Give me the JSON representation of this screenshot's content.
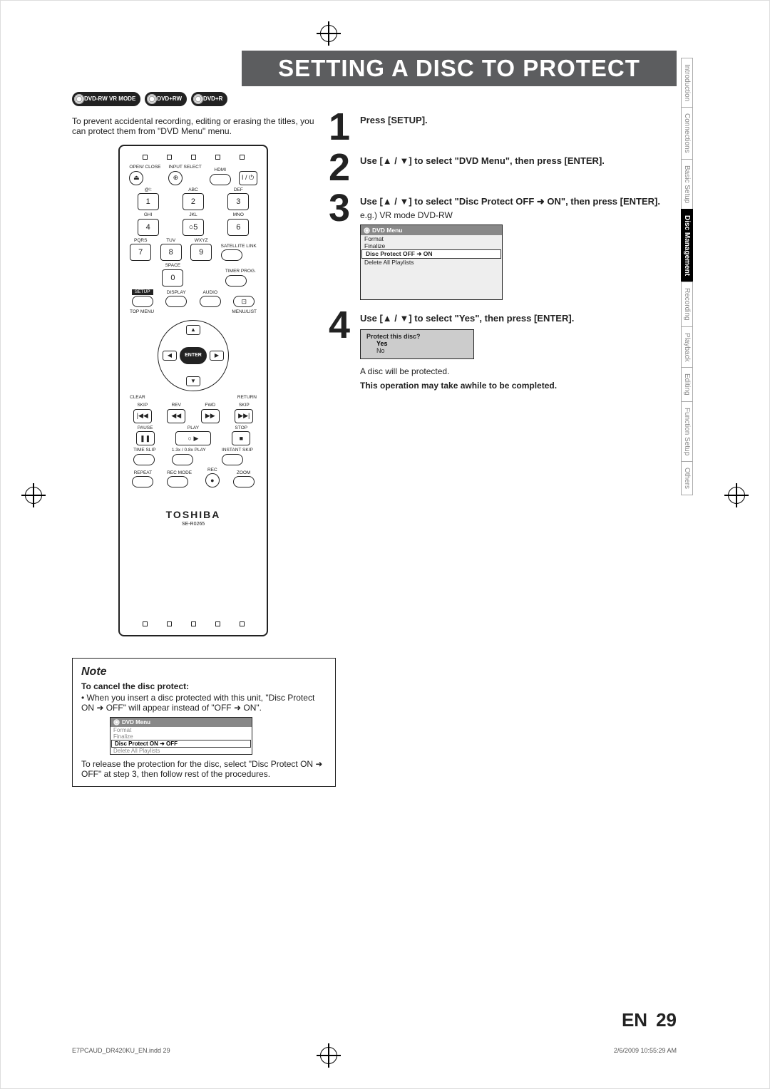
{
  "page": {
    "title": "SETTING A DISC TO PROTECT",
    "formats": [
      "DVD-RW VR MODE",
      "DVD+RW",
      "DVD+R"
    ],
    "intro": "To prevent accidental recording, editing or erasing the titles, you can protect them from \"DVD Menu\" menu.",
    "lang": "EN",
    "number": "29"
  },
  "remote": {
    "brand": "TOSHIBA",
    "model": "SE-R0265",
    "labels": {
      "open_close": "OPEN/\nCLOSE",
      "input_select": "INPUT\nSELECT",
      "hdmi": "HDMI",
      "power": "I / ⏻",
      "abc": "ABC",
      "def": "DEF",
      "ghi": "GHI",
      "jkl": "JKL",
      "mno": "MNO",
      "pqrs": "PQRS",
      "tuv": "TUV",
      "wxyz": "WXYZ",
      "satlink": "SATELLITE\nLINK",
      "space": "SPACE",
      "timer": "TIMER\nPROG.",
      "setup": "SETUP",
      "display": "DISPLAY",
      "audio": "AUDIO",
      "topmenu": "TOP MENU",
      "menulist": "MENU/LIST",
      "enter": "ENTER",
      "clear": "CLEAR",
      "return": "RETURN",
      "skip": "SKIP",
      "rev": "REV",
      "fwd": "FWD",
      "pause": "PAUSE",
      "play": "PLAY",
      "stop": "STOP",
      "timeslip": "TIME SLIP",
      "slow": "1.3x / 0.8x PLAY",
      "instant": "INSTANT SKIP",
      "repeat": "REPEAT",
      "recmode": "REC MODE",
      "rec": "REC",
      "zoom": "ZOOM"
    },
    "nums": [
      "1",
      "2",
      "3",
      "4",
      "5",
      "6",
      "7",
      "8",
      "9",
      "0"
    ]
  },
  "steps": [
    {
      "num": "1",
      "text": "Press [SETUP]."
    },
    {
      "num": "2",
      "text": "Use [▲ / ▼] to select \"DVD Menu\", then press [ENTER]."
    },
    {
      "num": "3",
      "text": "Use [▲ / ▼] to select \"Disc Protect OFF ➜ ON\", then press [ENTER].",
      "eg": "e.g.) VR mode DVD-RW"
    },
    {
      "num": "4",
      "text": "Use [▲ / ▼] to select \"Yes\", then press [ENTER]."
    }
  ],
  "step3menu": {
    "title": "DVD Menu",
    "items": [
      "Format",
      "Finalize",
      "Disc Protect OFF ➜ ON",
      "Delete All Playlists"
    ],
    "selected": 2
  },
  "step4confirm": {
    "question": "Protect this disc?",
    "options": [
      "Yes",
      "No"
    ],
    "selected": 0,
    "after": "A disc will be protected.",
    "warn": "This operation may take awhile to be completed."
  },
  "note": {
    "title": "Note",
    "subtitle": "To cancel the disc protect:",
    "line1": "When you insert a disc protected with this unit, \"Disc Protect ON ➜ OFF\" will appear instead of \"OFF ➜ ON\".",
    "menu": {
      "title": "DVD Menu",
      "items": [
        "Format",
        "Finalize",
        "Disc Protect ON ➜ OFF",
        "Delete All Playlists"
      ],
      "selected": 2
    },
    "line2": "To release the protection for the disc, select \"Disc Protect ON ➜ OFF\" at step 3, then follow rest of the procedures."
  },
  "tabs": [
    "Introduction",
    "Connections",
    "Basic Setup",
    "Disc Management",
    "Recording",
    "Playback",
    "Editing",
    "Function Setup",
    "Others"
  ],
  "active_tab": 3,
  "print": {
    "file": "E7PCAUD_DR420KU_EN.indd   29",
    "time": "2/6/2009   10:55:29 AM"
  }
}
